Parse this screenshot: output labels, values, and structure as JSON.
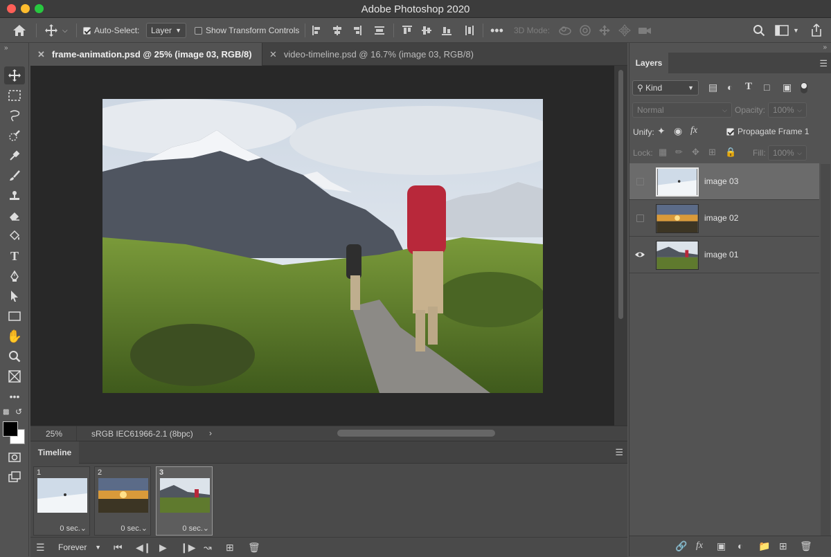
{
  "app": {
    "title": "Adobe Photoshop 2020"
  },
  "options_bar": {
    "auto_select_label": "Auto-Select:",
    "auto_select_checked": true,
    "auto_select_value": "Layer",
    "show_transform_label": "Show Transform Controls",
    "show_transform_checked": false,
    "mode_3d_label": "3D Mode:"
  },
  "tabs": [
    {
      "label": "frame-animation.psd @ 25% (image 03, RGB/8)",
      "active": true
    },
    {
      "label": "video-timeline.psd @ 16.7% (image 03, RGB/8)",
      "active": false
    }
  ],
  "status": {
    "zoom": "25%",
    "profile": "sRGB IEC61966-2.1 (8bpc)"
  },
  "timeline": {
    "tab_label": "Timeline",
    "frames": [
      {
        "number": "1",
        "delay": "0 sec.",
        "selected": false
      },
      {
        "number": "2",
        "delay": "0 sec.",
        "selected": false
      },
      {
        "number": "3",
        "delay": "0 sec.",
        "selected": true
      }
    ],
    "loop": "Forever"
  },
  "layers_panel": {
    "tab_label": "Layers",
    "filter": "Kind",
    "blend_mode": "Normal",
    "opacity_label": "Opacity:",
    "opacity_value": "100%",
    "unify_label": "Unify:",
    "propagate_label": "Propagate Frame 1",
    "propagate_checked": true,
    "lock_label": "Lock:",
    "fill_label": "Fill:",
    "fill_value": "100%",
    "layers": [
      {
        "name": "image 03",
        "visible": false,
        "selected": true
      },
      {
        "name": "image 02",
        "visible": false,
        "selected": false
      },
      {
        "name": "image 01",
        "visible": true,
        "selected": false
      }
    ]
  },
  "colors": {
    "foreground": "#000000",
    "background": "#ffffff"
  }
}
